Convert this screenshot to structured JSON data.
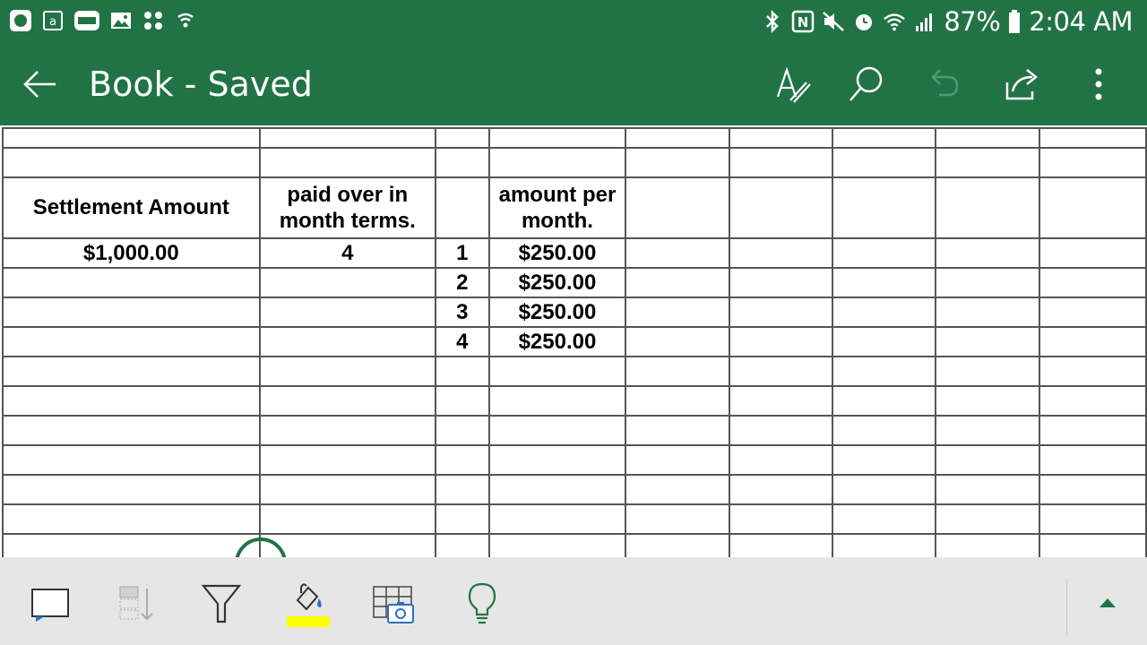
{
  "status_bar": {
    "left_icons": [
      "excel-app-icon",
      "amazon-icon",
      "slots-mania-icon",
      "gallery-icon",
      "apps-icon",
      "shield-icon"
    ],
    "right_icons": [
      "bluetooth-icon",
      "nfc-icon",
      "mute-icon",
      "alarm-icon",
      "wifi-icon",
      "signal-icon",
      "battery-icon"
    ],
    "battery": "87%",
    "time": "2:04 AM"
  },
  "app_bar": {
    "title": "Book - Saved",
    "actions": [
      "draw-icon",
      "search-icon",
      "undo-icon",
      "share-icon",
      "more-icon"
    ]
  },
  "sheet": {
    "rows": [
      [
        "",
        "",
        "",
        "",
        "",
        "",
        "",
        "",
        ""
      ],
      [
        "",
        "",
        "",
        "",
        "",
        "",
        "",
        "",
        ""
      ],
      [
        "Settlement Amount",
        "paid over in month terms.",
        "",
        "amount per month.",
        "",
        "",
        "",
        "",
        ""
      ],
      [
        "$1,000.00",
        "4",
        "1",
        "$250.00",
        "",
        "",
        "",
        "",
        ""
      ],
      [
        "",
        "",
        "2",
        "$250.00",
        "",
        "",
        "",
        "",
        ""
      ],
      [
        "",
        "",
        "3",
        "$250.00",
        "",
        "",
        "",
        "",
        ""
      ],
      [
        "",
        "",
        "4",
        "$250.00",
        "",
        "",
        "",
        "",
        ""
      ],
      [
        "",
        "",
        "",
        "",
        "",
        "",
        "",
        "",
        ""
      ],
      [
        "",
        "",
        "",
        "",
        "",
        "",
        "",
        "",
        ""
      ],
      [
        "",
        "",
        "",
        "",
        "",
        "",
        "",
        "",
        ""
      ],
      [
        "",
        "",
        "",
        "",
        "",
        "",
        "",
        "",
        ""
      ],
      [
        "",
        "",
        "",
        "",
        "",
        "",
        "",
        "",
        ""
      ],
      [
        "",
        "",
        "",
        "",
        "",
        "",
        "",
        "",
        ""
      ],
      [
        "",
        "",
        "",
        "",
        "",
        "",
        "",
        "",
        ""
      ]
    ]
  },
  "bottom_toolbar": {
    "tools": [
      "comment-icon",
      "sort-icon",
      "filter-icon",
      "fill-color-icon",
      "insert-table-picture-icon",
      "ideas-icon",
      "expand-caret-icon"
    ],
    "fill_color": "#ffff00",
    "accent": "#217346"
  }
}
